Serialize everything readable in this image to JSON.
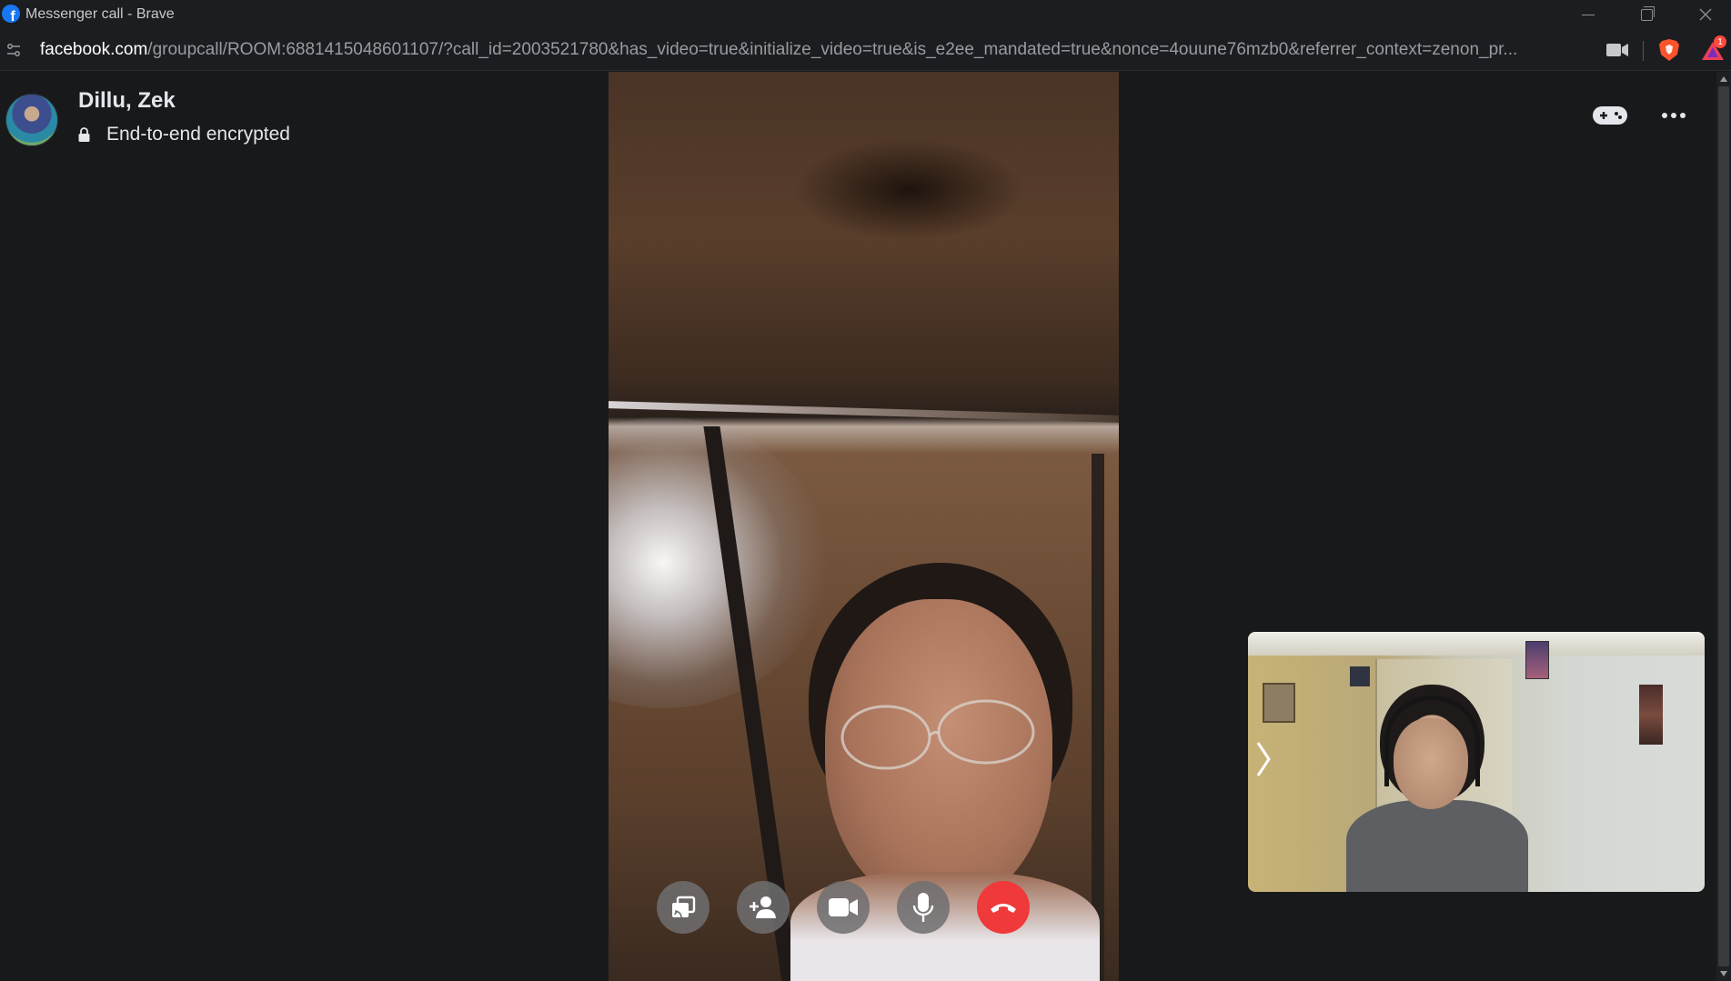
{
  "window": {
    "title": "Messenger call - Brave",
    "favicon": "facebook-icon",
    "controls": [
      "minimize",
      "restore",
      "close"
    ]
  },
  "addressbar": {
    "domain": "facebook.com",
    "path": "/groupcall/ROOM:6881415048601107/?call_id=2003521780&has_video=true&initialize_video=true&is_e2ee_mandated=true&nonce=4ouune76mzb0&referrer_context=zenon_pr...",
    "icons": [
      "site-info-icon",
      "camera-icon",
      "brave-shields-icon",
      "brave-rewards-icon"
    ],
    "rewards_badge": "1"
  },
  "call": {
    "participant_name": "Dillu, Zek",
    "encryption_label": "End-to-end encrypted",
    "top_actions": [
      "games-icon",
      "more-options-icon"
    ],
    "controls": [
      "share-screen",
      "add-people",
      "video",
      "microphone",
      "end-call"
    ],
    "end_call_color": "#f0393b"
  },
  "colors": {
    "background": "#18191b",
    "chrome": "#1c1d20",
    "accent": "#1877f2"
  }
}
